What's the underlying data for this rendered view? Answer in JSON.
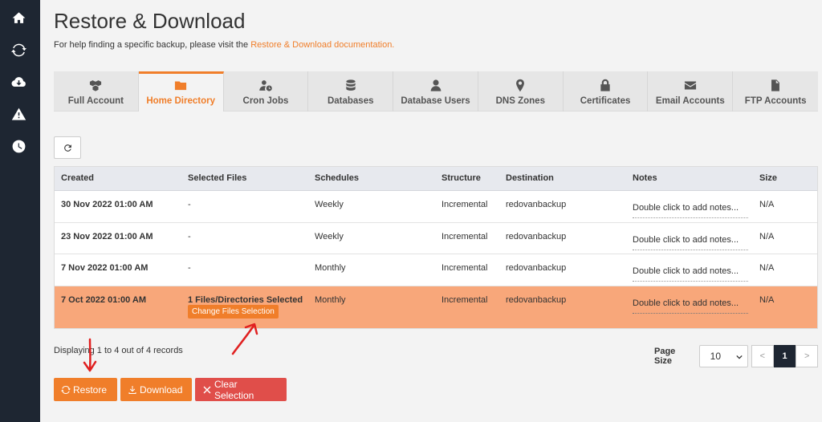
{
  "page": {
    "title": "Restore & Download",
    "help_prefix": "For help finding a specific backup, please visit the ",
    "help_link": "Restore & Download documentation."
  },
  "sidebar": {
    "icons": [
      "home-icon",
      "sync-icon",
      "cloud-download-icon",
      "warning-icon",
      "clock-icon"
    ]
  },
  "tabs": [
    {
      "label": "Full Account",
      "icon": "cubes-icon",
      "active": false
    },
    {
      "label": "Home Directory",
      "icon": "folder-icon",
      "active": true
    },
    {
      "label": "Cron Jobs",
      "icon": "user-clock-icon",
      "active": false
    },
    {
      "label": "Databases",
      "icon": "database-icon",
      "active": false
    },
    {
      "label": "Database Users",
      "icon": "user-icon",
      "active": false
    },
    {
      "label": "DNS Zones",
      "icon": "map-marker-icon",
      "active": false
    },
    {
      "label": "Certificates",
      "icon": "lock-icon",
      "active": false
    },
    {
      "label": "Email Accounts",
      "icon": "envelope-icon",
      "active": false
    },
    {
      "label": "FTP Accounts",
      "icon": "file-icon",
      "active": false
    }
  ],
  "table": {
    "columns": [
      "Created",
      "Selected Files",
      "Schedules",
      "Structure",
      "Destination",
      "Notes",
      "Size"
    ],
    "rows": [
      {
        "created": "30 Nov 2022 01:00 AM",
        "files": "-",
        "schedule": "Weekly",
        "structure": "Incremental",
        "destination": "redovanbackup",
        "notes": "Double click to add notes...",
        "size": "N/A",
        "selected": false
      },
      {
        "created": "23 Nov 2022 01:00 AM",
        "files": "-",
        "schedule": "Weekly",
        "structure": "Incremental",
        "destination": "redovanbackup",
        "notes": "Double click to add notes...",
        "size": "N/A",
        "selected": false
      },
      {
        "created": "7 Nov 2022 01:00 AM",
        "files": "-",
        "schedule": "Monthly",
        "structure": "Incremental",
        "destination": "redovanbackup",
        "notes": "Double click to add notes...",
        "size": "N/A",
        "selected": false
      },
      {
        "created": "7 Oct 2022 01:00 AM",
        "files": "1 Files/Directories Selected",
        "schedule": "Monthly",
        "structure": "Incremental",
        "destination": "redovanbackup",
        "notes": "Double click to add notes...",
        "size": "N/A",
        "selected": true
      }
    ],
    "change_selection_label": "Change Files Selection"
  },
  "footer": {
    "displaying": "Displaying 1 to 4 out of 4 records",
    "page_size_label": "Page Size",
    "page_size_value": "10",
    "prev": "<",
    "current_page": "1",
    "next": ">"
  },
  "actions": {
    "restore": "Restore",
    "download": "Download",
    "clear": "Clear Selection"
  },
  "colors": {
    "accent": "#f07e2a",
    "selected_row": "#f8a77a",
    "danger": "#e04e4a",
    "sidebar": "#1e2632",
    "annotation": "#e02020"
  }
}
